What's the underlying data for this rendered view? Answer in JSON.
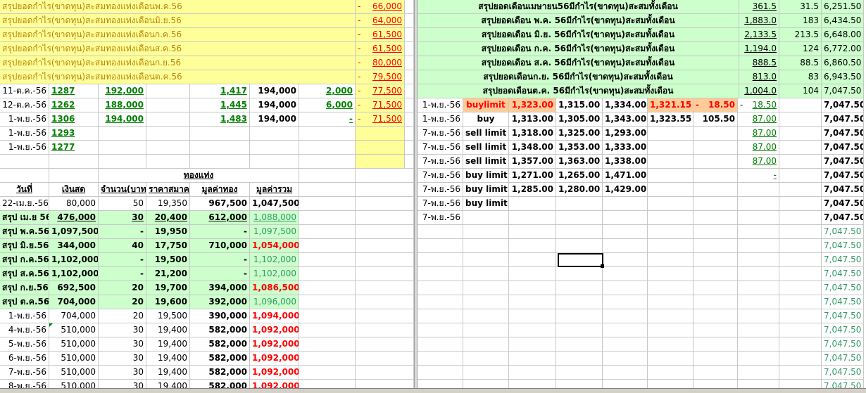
{
  "left_summary": [
    {
      "label": "สรุปยอดกำไร(ขาดทุน)สะสมทองแท่งเดือนพ.ค.56",
      "sign": "-",
      "value": "66,000"
    },
    {
      "label": "สรุปยอดกำไร(ขาดทุน)สะสมทองแท่งเดือนมิ.ย.56",
      "sign": "-",
      "value": "64,000"
    },
    {
      "label": "สรุปยอดกำไร(ขาดทุน)สะสมทองแท่งเดือนก.ค.56",
      "sign": "-",
      "value": "61,500"
    },
    {
      "label": "สรุปยอดกำไร(ขาดทุน)สะสมทองแท่งเดือนส.ค.56",
      "sign": "-",
      "value": "61,500"
    },
    {
      "label": "สรุปยอดกำไร(ขาดทุน)สะสมทองแท่งเดือนก.ย.56",
      "sign": "-",
      "value": "80,000"
    },
    {
      "label": "สรุปยอดกำไร(ขาดทุน)สะสมทองแท่งเดือนต.ค.56",
      "sign": "-",
      "value": "79,500"
    }
  ],
  "left_trades": [
    {
      "date": "11-ต.ค.-56",
      "id": "1287",
      "cash": "192,000",
      "price": "1,417",
      "amount": "194,000",
      "diff": "2,000",
      "sign": "-",
      "total": "77,500"
    },
    {
      "date": "12-ต.ค.-56",
      "id": "1262",
      "cash": "188,000",
      "price": "1,445",
      "amount": "194,000",
      "diff": "6,000",
      "sign": "-",
      "total": "71,500"
    },
    {
      "date": "1-พ.ย.-56",
      "id": "1306",
      "cash": "194,000",
      "price": "1,483",
      "amount": "194,000",
      "diff": "-",
      "sign": "-",
      "total": "71,500"
    },
    {
      "date": "1-พ.ย.-56",
      "id": "1293",
      "cash": "",
      "price": "",
      "amount": "",
      "diff": "",
      "sign": "",
      "total": ""
    },
    {
      "date": "1-พ.ย.-56",
      "id": "1277",
      "cash": "",
      "price": "",
      "amount": "",
      "diff": "",
      "sign": "",
      "total": ""
    }
  ],
  "gold_header": "ทองแท่ง",
  "gold_columns": [
    "วันที่",
    "เงินสด",
    "จำนวน(บาท)",
    "ราคาสมาคม",
    "มูลค่าทอง",
    "มูลค่ารวม"
  ],
  "gold_rows": [
    {
      "date": "22-เม.ย.-56",
      "cash": "80,000",
      "qty": "50",
      "price": "19,350",
      "gold": "967,500",
      "total": "1,047,500",
      "style": "plain"
    },
    {
      "date": "สรุป เม.ย 56",
      "cash": "476,000",
      "qty": "30",
      "price": "20,400",
      "gold": "612,000",
      "total": "1,088,000",
      "style": "sum-u"
    },
    {
      "date": "สรุป พ.ค.56",
      "cash": "1,097,500",
      "qty": "-",
      "price": "19,950",
      "gold": "-",
      "total": "1,097,500",
      "style": "sum-g"
    },
    {
      "date": "สรุป มิ.ย.56",
      "cash": "344,000",
      "qty": "40",
      "price": "17,750",
      "gold": "710,000",
      "total": "1,054,000",
      "style": "sum-r"
    },
    {
      "date": "สรุป ก.ค.56",
      "cash": "1,102,000",
      "qty": "-",
      "price": "19,500",
      "gold": "-",
      "total": "1,102,000",
      "style": "sum-g"
    },
    {
      "date": "สรุป ส.ค.56",
      "cash": "1,102,000",
      "qty": "-",
      "price": "21,200",
      "gold": "-",
      "total": "1,102,000",
      "style": "sum-g"
    },
    {
      "date": "สรุป ก.ย.56",
      "cash": "692,500",
      "qty": "20",
      "price": "19,700",
      "gold": "394,000",
      "total": "1,086,500",
      "style": "sum-r"
    },
    {
      "date": "สรุป ต.ค.56",
      "cash": "704,000",
      "qty": "20",
      "price": "19,600",
      "gold": "392,000",
      "total": "1,096,000",
      "style": "sum-g"
    },
    {
      "date": "1-พ.ย.-56",
      "cash": "704,000",
      "qty": "20",
      "price": "19,500",
      "gold": "390,000",
      "total": "1,094,000",
      "style": "day"
    },
    {
      "date": "4-พ.ย.-56",
      "cash": "510,000",
      "qty": "30",
      "price": "19,400",
      "gold": "582,000",
      "total": "1,092,000",
      "style": "day"
    },
    {
      "date": "5-พ.ย.-56",
      "cash": "510,000",
      "qty": "30",
      "price": "19,400",
      "gold": "582,000",
      "total": "1,092,000",
      "style": "day"
    },
    {
      "date": "6-พ.ย.-56",
      "cash": "510,000",
      "qty": "30",
      "price": "19,400",
      "gold": "582,000",
      "total": "1,092,000",
      "style": "day"
    },
    {
      "date": "7-พ.ย.-56",
      "cash": "510,000",
      "qty": "30",
      "price": "19,400",
      "gold": "582,000",
      "total": "1,092,000",
      "style": "day"
    },
    {
      "date": "8-พ.ย.-56",
      "cash": "510,000",
      "qty": "30",
      "price": "19,400",
      "gold": "582,000",
      "total": "1,092,000",
      "style": "day"
    }
  ],
  "right_summary": [
    {
      "label": "สรุปยอดเดือนเมษายน56มีกำไร(ขาดทุน)สะสมทั้งเดือน",
      "v1": "361.5",
      "v2": "31.5",
      "v3": "6,251.50"
    },
    {
      "label": "สรุปยอดเดือน พ.ค. 56มีกำไร(ขาดทุน)สะสมทั้งเดือน",
      "v1": "1,883.0",
      "v2": "183",
      "v3": "6,434.50"
    },
    {
      "label": "สรุปยอดเดือน มิ.ย. 56มีกำไร(ขาดทุน)สะสมทั้งเดือน",
      "v1": "2,133.5",
      "v2": "213.5",
      "v3": "6,648.00"
    },
    {
      "label": "สรุปยอดเดือน ก.ค. 56มีกำไร(ขาดทุน)สะสมทั้งเดือน",
      "v1": "1,194.0",
      "v2": "124",
      "v3": "6,772.00"
    },
    {
      "label": "สรุปยอดเดือน ส.ค. 56มีกำไร(ขาดทุน)สะสมทั้งเดือน",
      "v1": "888.5",
      "v2": "88.5",
      "v3": "6,860.50"
    },
    {
      "label": "สรุปยอดเดือนก.ย. 56มีกำไร(ขาดทุน)สะสมทั้งเดือน",
      "v1": "813.0",
      "v2": "83",
      "v3": "6,943.50"
    },
    {
      "label": "สรุปยอดเดือนต.ค. 56มีกำไร(ขาดทุน)สะสมทั้งเดือน",
      "v1": "1,004.0",
      "v2": "104",
      "v3": "7,047.50"
    }
  ],
  "right_orders": [
    {
      "date": "1-พ.ย.-56",
      "type": "buylimit",
      "p1": "1,323.00",
      "p2": "1,315.00",
      "p3": "1,334.00",
      "p4": "1,321.15",
      "p5a": "-",
      "p5": "18.50",
      "dash": "-",
      "p6": "18.50",
      "bal": "7,047.50",
      "hl": true
    },
    {
      "date": "1-พ.ย.-56",
      "type": "buy",
      "p1": "1,313.00",
      "p2": "1,305.00",
      "p3": "1,343.00",
      "p4": "1,323.55",
      "p5a": "",
      "p5": "105.50",
      "dash": "",
      "p6": "87.00",
      "bal": "7,047.50",
      "hl": false
    },
    {
      "date": "7-พ.ย.-56",
      "type": "sell limit",
      "p1": "1,318.00",
      "p2": "1,325.00",
      "p3": "1,293.00",
      "p4": "",
      "p5a": "",
      "p5": "",
      "dash": "",
      "p6": "87.00",
      "bal": "7,047.50",
      "hl": false
    },
    {
      "date": "7-พ.ย.-56",
      "type": "sell limit",
      "p1": "1,348.00",
      "p2": "1,353.00",
      "p3": "1,333.00",
      "p4": "",
      "p5a": "",
      "p5": "",
      "dash": "",
      "p6": "87.00",
      "bal": "7,047.50",
      "hl": false
    },
    {
      "date": "7-พ.ย.-56",
      "type": "sell limit",
      "p1": "1,357.00",
      "p2": "1,363.00",
      "p3": "1,338.00",
      "p4": "",
      "p5a": "",
      "p5": "",
      "dash": "",
      "p6": "87.00",
      "bal": "7,047.50",
      "hl": false
    },
    {
      "date": "7-พ.ย.-56",
      "type": "buy limit",
      "p1": "1,271.00",
      "p2": "1,265.00",
      "p3": "1,471.00",
      "p4": "",
      "p5a": "",
      "p5": "",
      "dash": "",
      "p6": "-",
      "bal": "7,047.50",
      "hl": false
    },
    {
      "date": "7-พ.ย.-56",
      "type": "buy limit",
      "p1": "1,285.00",
      "p2": "1,280.00",
      "p3": "1,429.00",
      "p4": "",
      "p5a": "",
      "p5": "",
      "dash": "",
      "p6": "",
      "bal": "7,047.50",
      "hl": false
    },
    {
      "date": "7-พ.ย.-56",
      "type": "buy limit",
      "p1": "",
      "p2": "",
      "p3": "",
      "p4": "",
      "p5a": "",
      "p5": "",
      "dash": "",
      "p6": "",
      "bal": "7,047.50",
      "hl": false
    },
    {
      "date": "7-พ.ย.-56",
      "type": "",
      "p1": "",
      "p2": "",
      "p3": "",
      "p4": "",
      "p5a": "",
      "p5": "",
      "dash": "",
      "p6": "",
      "bal": "7,047.50",
      "hl": false
    }
  ],
  "right_balance_tail": [
    "7,047.50",
    "7,047.50",
    "7,047.50",
    "7,047.50",
    "7,047.50",
    "7,047.50",
    "7,047.50",
    "7,047.50",
    "7,047.50",
    "7,047.50",
    "7,047.50",
    "7,047.50"
  ],
  "colors": {
    "yellow": "#ffff99",
    "lightgreen": "#ccffcc",
    "orange": "#ffcc99",
    "red": "#ff0000",
    "green": "#008000"
  }
}
